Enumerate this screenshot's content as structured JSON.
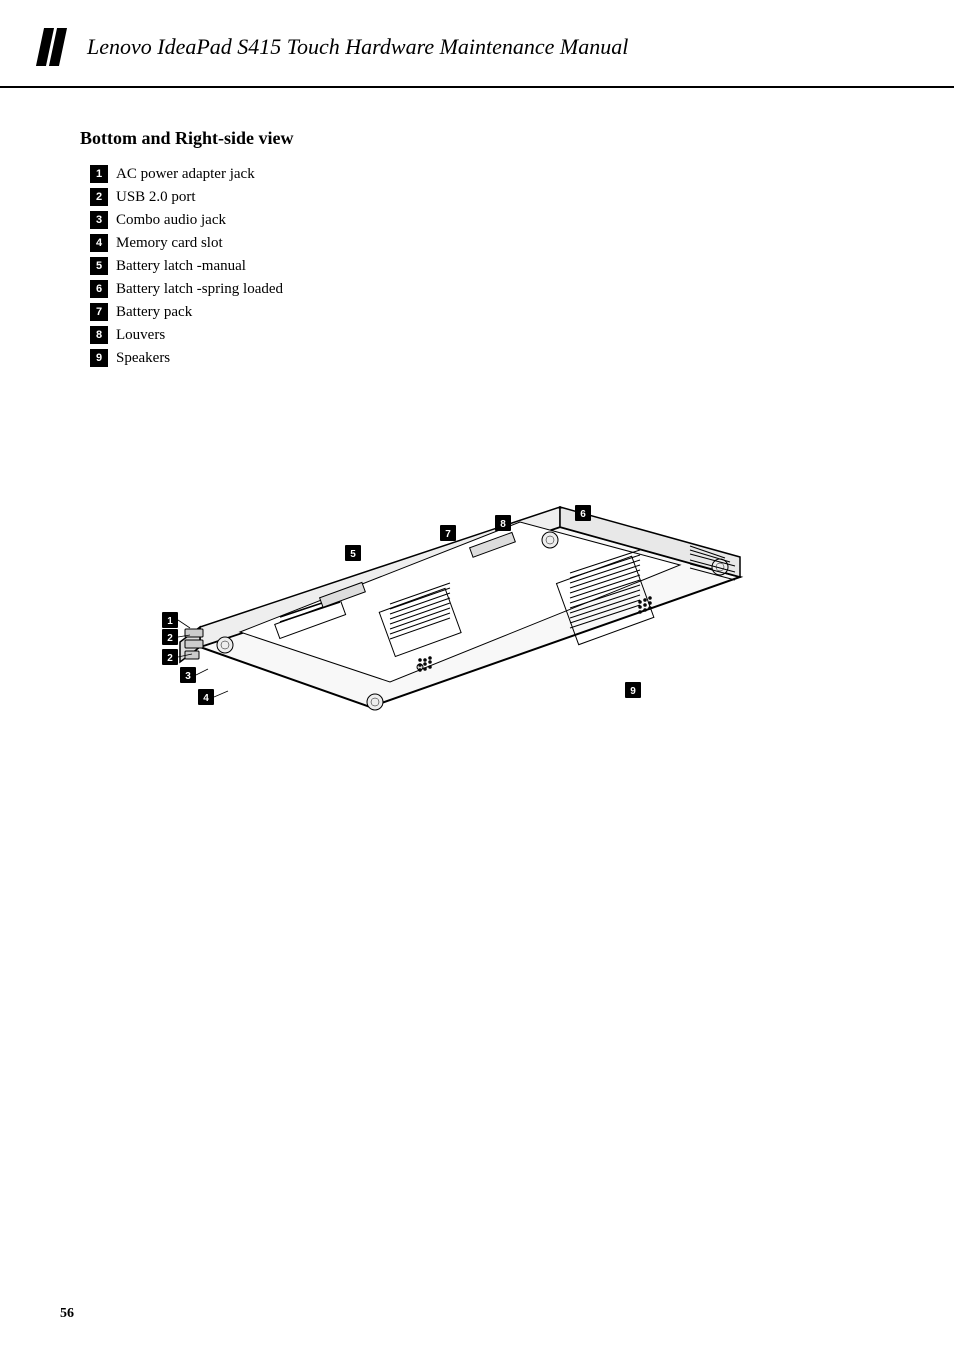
{
  "header": {
    "title": "Lenovo IdeaPad S415 Touch Hardware Maintenance Manual"
  },
  "section": {
    "title": "Bottom and Right-side view"
  },
  "items": [
    {
      "number": "1",
      "label": "AC power adapter jack"
    },
    {
      "number": "2",
      "label": "USB 2.0 port"
    },
    {
      "number": "3",
      "label": "Combo audio jack"
    },
    {
      "number": "4",
      "label": "Memory card slot"
    },
    {
      "number": "5",
      "label": "Battery latch -manual"
    },
    {
      "number": "6",
      "label": "Battery latch -spring loaded"
    },
    {
      "number": "7",
      "label": "Battery pack"
    },
    {
      "number": "8",
      "label": "Louvers"
    },
    {
      "number": "9",
      "label": "Speakers"
    }
  ],
  "footer": {
    "page_number": "56"
  }
}
